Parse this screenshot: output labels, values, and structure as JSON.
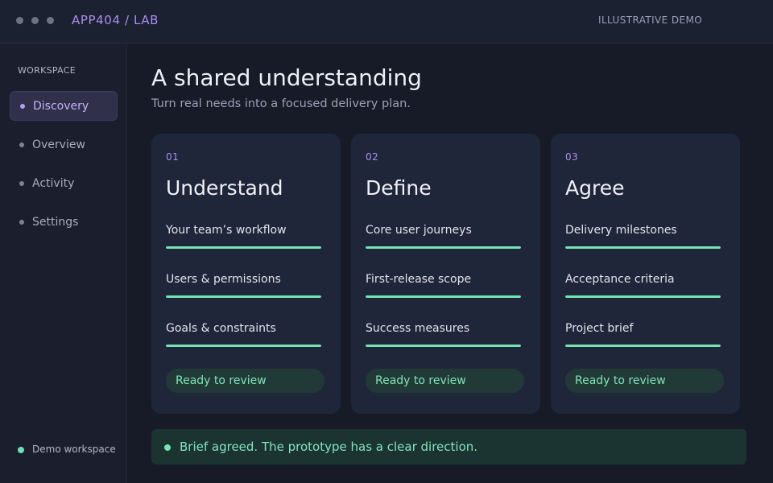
{
  "window": {
    "title": "APP404 / LAB",
    "tag": "ILLUSTRATIVE DEMO"
  },
  "sidebar": {
    "heading": "WORKSPACE",
    "items": [
      {
        "label": "Discovery",
        "active": true
      },
      {
        "label": "Overview",
        "active": false
      },
      {
        "label": "Activity",
        "active": false
      },
      {
        "label": "Settings",
        "active": false
      }
    ],
    "footer": "Demo workspace"
  },
  "main": {
    "title": "A shared understanding",
    "subtitle": "Turn real needs into a focused delivery plan.",
    "cards": [
      {
        "number": "01",
        "title": "Understand",
        "items": [
          {
            "label": "Your team’s workflow",
            "progress": 1.0
          },
          {
            "label": "Users & permissions",
            "progress": 1.0
          },
          {
            "label": "Goals & constraints",
            "progress": 1.0
          }
        ],
        "status": "Ready to review"
      },
      {
        "number": "02",
        "title": "Define",
        "items": [
          {
            "label": "Core user journeys",
            "progress": 1.0
          },
          {
            "label": "First-release scope",
            "progress": 1.0
          },
          {
            "label": "Success measures",
            "progress": 1.0
          }
        ],
        "status": "Ready to review"
      },
      {
        "number": "03",
        "title": "Agree",
        "items": [
          {
            "label": "Delivery milestones",
            "progress": 1.0
          },
          {
            "label": "Acceptance criteria",
            "progress": 1.0
          },
          {
            "label": "Project brief",
            "progress": 1.0
          }
        ],
        "status": "Ready to review"
      }
    ],
    "banner": "Brief agreed. The prototype has a clear direction."
  },
  "colors": {
    "accent": "#a98ef0",
    "success": "#74e3b5",
    "background": "#171b27",
    "card": "#20263a"
  }
}
